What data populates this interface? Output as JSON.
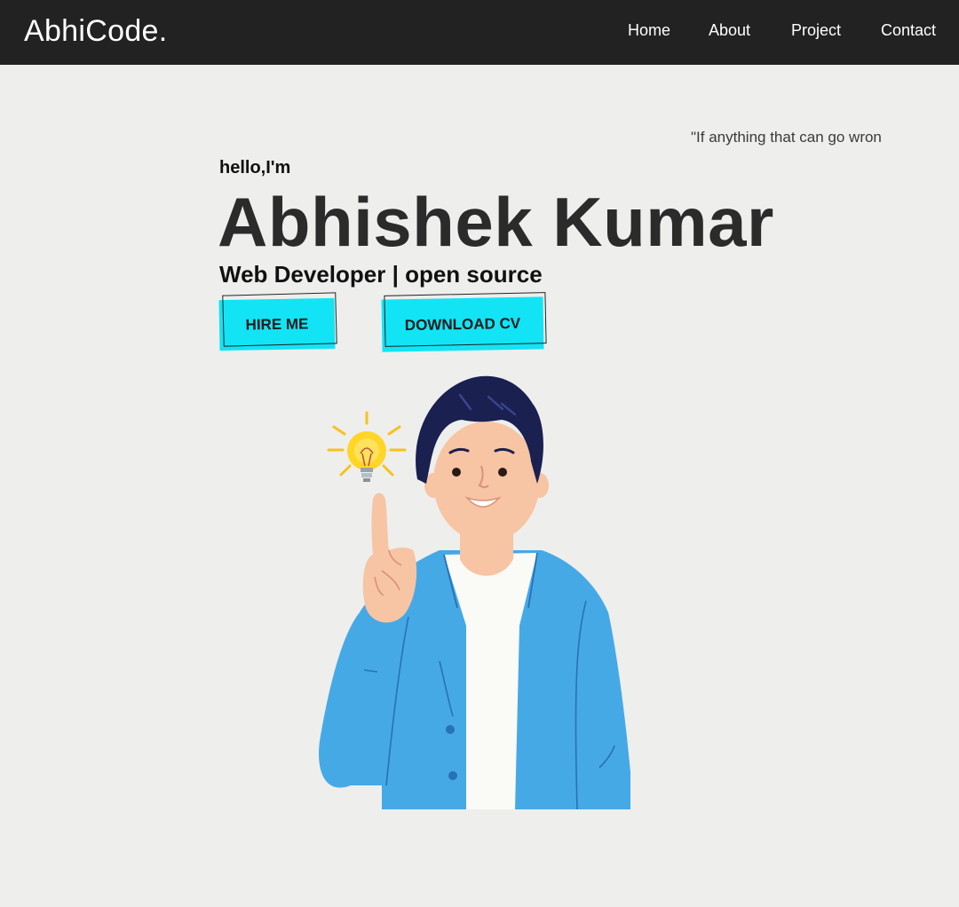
{
  "nav": {
    "brand": "AbhiCode.",
    "links": [
      "Home",
      "About",
      "Project",
      "Contact"
    ]
  },
  "hero": {
    "quote": "\"If anything that can go wron",
    "greeting": "hello,I'm",
    "name": "Abhishek Kumar",
    "role": "Web Developer | open source",
    "buttons": {
      "hire": "HIRE ME",
      "cv": "DOWNLOAD CV"
    }
  },
  "colors": {
    "navbar": "#222222",
    "background": "#eeeeed",
    "button_accent": "#12e4f5",
    "jacket": "#45a9e6",
    "hair": "#1a2050",
    "skin": "#f7c4a4"
  },
  "icons": [
    "lightbulb-icon",
    "developer-avatar-illustration"
  ]
}
